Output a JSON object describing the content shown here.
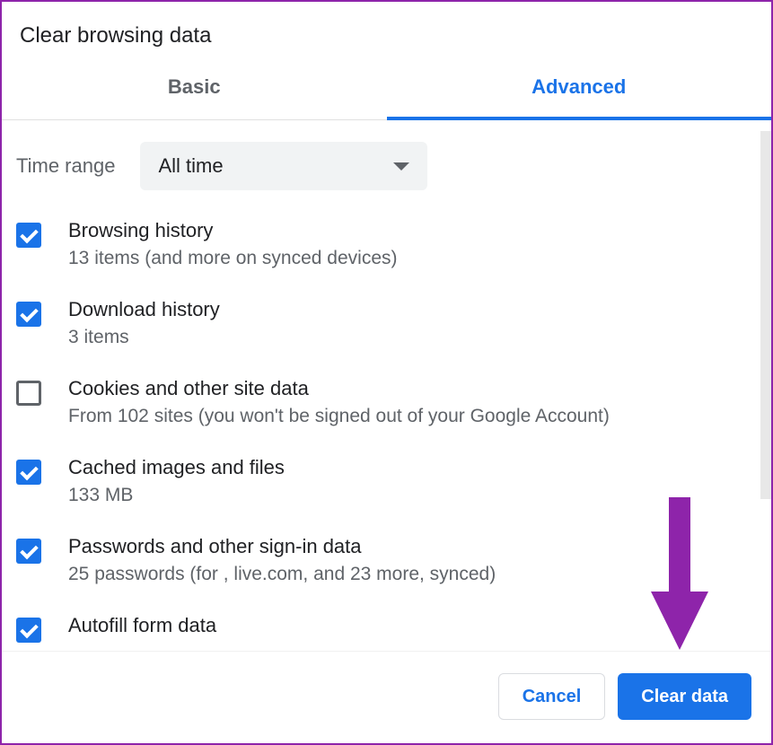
{
  "dialog": {
    "title": "Clear browsing data"
  },
  "tabs": {
    "basic": "Basic",
    "advanced": "Advanced"
  },
  "time_range": {
    "label": "Time range",
    "value": "All time"
  },
  "items": [
    {
      "title": "Browsing history",
      "sub": "13 items (and more on synced devices)",
      "checked": true
    },
    {
      "title": "Download history",
      "sub": "3 items",
      "checked": true
    },
    {
      "title": "Cookies and other site data",
      "sub": "From 102 sites (you won't be signed out of your Google Account)",
      "checked": false
    },
    {
      "title": "Cached images and files",
      "sub": "133 MB",
      "checked": true
    },
    {
      "title": "Passwords and other sign-in data",
      "sub": "25 passwords (for , live.com, and 23 more, synced)",
      "checked": true
    },
    {
      "title": "Autofill form data",
      "sub": "",
      "checked": true
    }
  ],
  "footer": {
    "cancel": "Cancel",
    "clear": "Clear data"
  },
  "annotation": {
    "arrow_color": "#8e24aa"
  }
}
